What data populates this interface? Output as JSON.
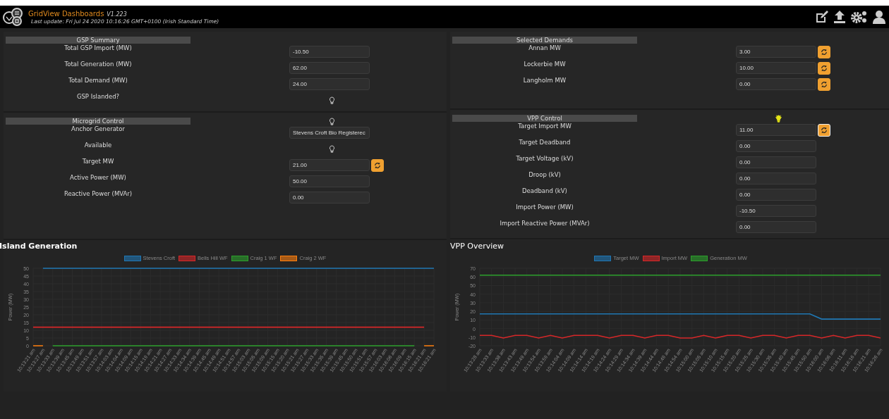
{
  "header": {
    "title": "GridView Dashboards",
    "version": "V1.223",
    "last_update": "Last update: Fri Jul 24 2020 10:16:26 GMT+0100 (Irish Standard Time)"
  },
  "panels": [
    {
      "sections": [
        {
          "title": "GSP Summary",
          "rows": [
            {
              "kind": "field",
              "label": "Total GSP Import (MW)",
              "value": "-10.50"
            },
            {
              "kind": "field",
              "label": "Total Generation (MW)",
              "value": "62.00"
            },
            {
              "kind": "field",
              "label": "Total Demand (MW)",
              "value": "24.00"
            },
            {
              "kind": "bulb",
              "label": "GSP Islanded?",
              "on": false
            }
          ]
        },
        {
          "title": "Microgrid Control",
          "bulb": {
            "on": false
          },
          "rows": [
            {
              "kind": "field",
              "label": "Anchor Generator",
              "value": "Stevens Croft Bio Registerec"
            },
            {
              "kind": "bulb",
              "label": "Available",
              "on": false
            },
            {
              "kind": "refresh",
              "label": "Target MW",
              "value": "21.00",
              "focused": false
            },
            {
              "kind": "field",
              "label": "Active Power (MW)",
              "value": "50.00"
            },
            {
              "kind": "field",
              "label": "Reactive Power (MVAr)",
              "value": "0.00"
            }
          ]
        }
      ]
    },
    {
      "sections": [
        {
          "title": "Selected Demands",
          "rows": [
            {
              "kind": "refresh",
              "label": "Annan MW",
              "value": "3.00",
              "focused": false
            },
            {
              "kind": "refresh",
              "label": "Lockerbie MW",
              "value": "10.00",
              "focused": false
            },
            {
              "kind": "refresh",
              "label": "Langholm MW",
              "value": "0.00",
              "focused": false
            }
          ]
        },
        {
          "title": "VPP Control",
          "bulb": {
            "on": true
          },
          "rows": [
            {
              "kind": "refresh",
              "label": "Target Import MW",
              "value": "11.00",
              "focused": true
            },
            {
              "kind": "field",
              "label": "Target Deadband",
              "value": "0.00"
            },
            {
              "kind": "field",
              "label": "Target Voltage (kV)",
              "value": "0.00"
            },
            {
              "kind": "field",
              "label": "Droop (kV)",
              "value": "0.00"
            },
            {
              "kind": "field",
              "label": "Deadband (kV)",
              "value": "0.00"
            },
            {
              "kind": "field",
              "label": "Import Power (MW)",
              "value": "-10.50"
            },
            {
              "kind": "field",
              "label": "Import Reactive Power (MVAr)",
              "value": "0.00"
            }
          ]
        }
      ]
    }
  ],
  "charts": [
    {
      "title": "Island Generation",
      "chart_data": {
        "type": "line",
        "ylabel": "Power (MW)",
        "ylim": [
          0,
          50
        ],
        "yticks": [
          0,
          5,
          10,
          15,
          20,
          25,
          30,
          35,
          40,
          45,
          50
        ],
        "categories": [
          "10:13:21 am",
          "10:13:27 am",
          "10:13:33 am",
          "10:13:39 am",
          "10:13:45 am",
          "10:13:49 am",
          "10:13:51 am",
          "10:13:57 am",
          "10:14:03 am",
          "10:14:04 am",
          "10:14:09 am",
          "10:14:15 am",
          "10:14:19 am",
          "10:14:21 am",
          "10:14:27 am",
          "10:14:33 am",
          "10:14:34 am",
          "10:14:39 am",
          "10:14:45 am",
          "10:14:49 am",
          "10:14:51 am",
          "10:14:57 am",
          "10:15:03 am",
          "10:15:05 am",
          "10:15:09 am",
          "10:15:15 am",
          "10:15:20 am",
          "10:15:21 am",
          "10:15:27 am",
          "10:15:33 am",
          "10:15:35 am",
          "10:15:39 am",
          "10:15:45 am",
          "10:15:50 am",
          "10:15:51 am",
          "10:15:57 am",
          "10:16:03 am",
          "10:16:06 am",
          "10:16:09 am",
          "10:16:15 am",
          "10:16:21 am",
          "10:16:21 am"
        ],
        "series": [
          {
            "name": "Stevens Croft",
            "color": "#1f77b4",
            "values": [
              null,
              50,
              50,
              50,
              50,
              50,
              50,
              50,
              50,
              50,
              50,
              50,
              50,
              50,
              50,
              50,
              50,
              50,
              50,
              50,
              50,
              50,
              50,
              50,
              50,
              50,
              50,
              50,
              50,
              50,
              50,
              50,
              50,
              50,
              50,
              50,
              50,
              50,
              50,
              50,
              50,
              50
            ]
          },
          {
            "name": "Bells Hill WF",
            "color": "#d62728",
            "values": [
              12,
              12,
              12,
              12,
              12,
              12,
              12,
              12,
              12,
              12,
              12,
              12,
              12,
              12,
              12,
              12,
              12,
              12,
              12,
              12,
              12,
              12,
              12,
              12,
              12,
              12,
              12,
              12,
              12,
              12,
              12,
              12,
              12,
              12,
              12,
              12,
              12,
              12,
              12,
              12,
              12,
              null
            ]
          },
          {
            "name": "Craig 1 WF",
            "color": "#2ca02c",
            "values": [
              null,
              null,
              0,
              0,
              0,
              0,
              0,
              0,
              0,
              0,
              0,
              0,
              0,
              0,
              0,
              0,
              0,
              0,
              0,
              0,
              0,
              0,
              0,
              0,
              0,
              0,
              0,
              0,
              0,
              0,
              0,
              0,
              0,
              0,
              0,
              0,
              0,
              0,
              0,
              0,
              null,
              null
            ]
          },
          {
            "name": "Craig 2 WF",
            "color": "#ff7f0e",
            "values": [
              0,
              0,
              null,
              null,
              null,
              null,
              null,
              null,
              null,
              null,
              null,
              null,
              null,
              null,
              null,
              null,
              null,
              null,
              null,
              null,
              null,
              null,
              null,
              null,
              null,
              null,
              null,
              null,
              null,
              null,
              null,
              null,
              null,
              null,
              null,
              null,
              null,
              null,
              null,
              null,
              0,
              0
            ]
          }
        ],
        "grid": true,
        "legend": "top"
      }
    },
    {
      "title": "VPP Overview",
      "chart_data": {
        "type": "line",
        "ylabel": "Power (MW)",
        "ylim": [
          -20,
          70
        ],
        "yticks": [
          -20,
          -10,
          0,
          10,
          20,
          30,
          40,
          50,
          60,
          70
        ],
        "categories": [
          "10:13:28 am",
          "10:13:33 am",
          "10:13:38 am",
          "10:13:43 am",
          "10:13:49 am",
          "10:13:54 am",
          "10:13:59 am",
          "10:14:04 am",
          "10:14:09 am",
          "10:14:14 am",
          "10:14:19 am",
          "10:14:24 am",
          "10:14:29 am",
          "10:14:34 am",
          "10:14:39 am",
          "10:14:44 am",
          "10:14:49 am",
          "10:14:54 am",
          "10:15:00 am",
          "10:15:05 am",
          "10:15:10 am",
          "10:15:15 am",
          "10:15:20 am",
          "10:15:25 am",
          "10:15:30 am",
          "10:15:35 am",
          "10:15:40 am",
          "10:15:45 am",
          "10:15:50 am",
          "10:16:00 am",
          "10:16:06 am",
          "10:16:11 am",
          "10:16:16 am",
          "10:16:21 am",
          "10:16:26 am"
        ],
        "series": [
          {
            "name": "Target MW",
            "color": "#1f77b4",
            "values": [
              17,
              17,
              17,
              17,
              17,
              17,
              17,
              17,
              17,
              17,
              17,
              17,
              17,
              17,
              17,
              17,
              17,
              17,
              17,
              17,
              17,
              17,
              17,
              17,
              17,
              17,
              17,
              17,
              17,
              11,
              11,
              11,
              11,
              11,
              11
            ]
          },
          {
            "name": "Import MW",
            "color": "#d62728",
            "values": [
              -8,
              -8,
              -11,
              -8,
              -8,
              -11,
              -8,
              -11,
              -8,
              -8,
              -8,
              -11,
              -8,
              -8,
              -11,
              -8,
              -8,
              -11,
              -11,
              -8,
              -11,
              -8,
              -8,
              -11,
              -8,
              -8,
              -11,
              -8,
              -8,
              -11,
              -8,
              -11,
              -8,
              -8,
              -11
            ]
          },
          {
            "name": "Generation MW",
            "color": "#2ca02c",
            "values": [
              62,
              62,
              62,
              62,
              62,
              62,
              62,
              62,
              62,
              62,
              62,
              62,
              62,
              62,
              62,
              62,
              62,
              62,
              62,
              62,
              62,
              62,
              62,
              62,
              62,
              62,
              62,
              62,
              62,
              62,
              62,
              62,
              62,
              62,
              62
            ]
          }
        ],
        "grid": true,
        "legend": "top"
      }
    }
  ]
}
